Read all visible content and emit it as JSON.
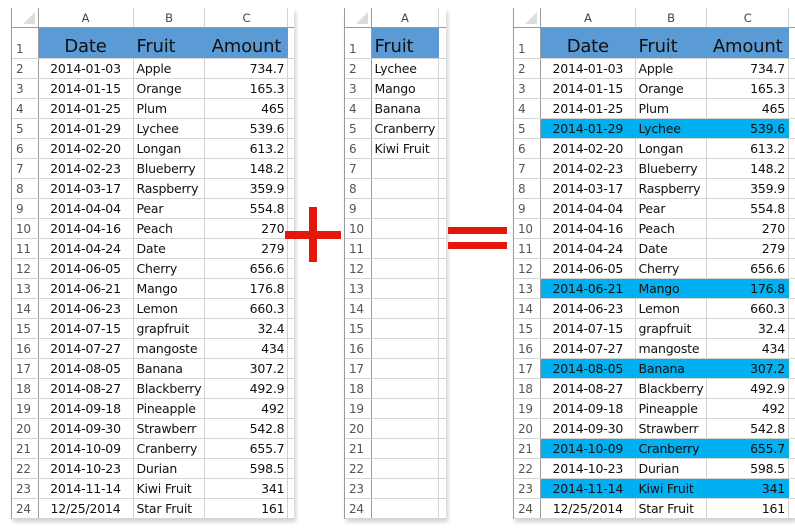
{
  "sheet1": {
    "col_headers": [
      "A",
      "B",
      "C"
    ],
    "header": {
      "row": "1",
      "cols": [
        "Date",
        "Fruit",
        "Amount"
      ]
    },
    "rows": [
      {
        "n": "2",
        "date": "2014-01-03",
        "fruit": "Apple",
        "amount": "734.7"
      },
      {
        "n": "3",
        "date": "2014-01-15",
        "fruit": "Orange",
        "amount": "165.3"
      },
      {
        "n": "4",
        "date": "2014-01-25",
        "fruit": "Plum",
        "amount": "465"
      },
      {
        "n": "5",
        "date": "2014-01-29",
        "fruit": "Lychee",
        "amount": "539.6"
      },
      {
        "n": "6",
        "date": "2014-02-20",
        "fruit": "Longan",
        "amount": "613.2"
      },
      {
        "n": "7",
        "date": "2014-02-23",
        "fruit": "Blueberry",
        "amount": "148.2"
      },
      {
        "n": "8",
        "date": "2014-03-17",
        "fruit": "Raspberry",
        "amount": "359.9"
      },
      {
        "n": "9",
        "date": "2014-04-04",
        "fruit": "Pear",
        "amount": "554.8"
      },
      {
        "n": "10",
        "date": "2014-04-16",
        "fruit": "Peach",
        "amount": "270"
      },
      {
        "n": "11",
        "date": "2014-04-24",
        "fruit": "Date",
        "amount": "279"
      },
      {
        "n": "12",
        "date": "2014-06-05",
        "fruit": "Cherry",
        "amount": "656.6"
      },
      {
        "n": "13",
        "date": "2014-06-21",
        "fruit": "Mango",
        "amount": "176.8"
      },
      {
        "n": "14",
        "date": "2014-06-23",
        "fruit": "Lemon",
        "amount": "660.3"
      },
      {
        "n": "15",
        "date": "2014-07-15",
        "fruit": "grapfruit",
        "amount": "32.4"
      },
      {
        "n": "16",
        "date": "2014-07-27",
        "fruit": "mangoste",
        "amount": "434"
      },
      {
        "n": "17",
        "date": "2014-08-05",
        "fruit": "Banana",
        "amount": "307.2"
      },
      {
        "n": "18",
        "date": "2014-08-27",
        "fruit": "Blackberry",
        "amount": "492.9"
      },
      {
        "n": "19",
        "date": "2014-09-18",
        "fruit": "Pineapple",
        "amount": "492"
      },
      {
        "n": "20",
        "date": "2014-09-30",
        "fruit": "Strawberr",
        "amount": "542.8"
      },
      {
        "n": "21",
        "date": "2014-10-09",
        "fruit": "Cranberry",
        "amount": "655.7"
      },
      {
        "n": "22",
        "date": "2014-10-23",
        "fruit": "Durian",
        "amount": "598.5"
      },
      {
        "n": "23",
        "date": "2014-11-14",
        "fruit": "Kiwi Fruit",
        "amount": "341"
      },
      {
        "n": "24",
        "date": "12/25/2014",
        "fruit": "Star Fruit",
        "amount": "161"
      }
    ]
  },
  "sheet2": {
    "col_headers": [
      "A"
    ],
    "header": {
      "row": "1",
      "cols": [
        "Fruit"
      ]
    },
    "rows": [
      {
        "n": "2",
        "fruit": "Lychee"
      },
      {
        "n": "3",
        "fruit": "Mango"
      },
      {
        "n": "4",
        "fruit": "Banana"
      },
      {
        "n": "5",
        "fruit": "Cranberry"
      },
      {
        "n": "6",
        "fruit": "Kiwi Fruit"
      },
      {
        "n": "7",
        "fruit": ""
      },
      {
        "n": "8",
        "fruit": ""
      },
      {
        "n": "9",
        "fruit": ""
      },
      {
        "n": "10",
        "fruit": ""
      },
      {
        "n": "11",
        "fruit": ""
      },
      {
        "n": "12",
        "fruit": ""
      },
      {
        "n": "13",
        "fruit": ""
      },
      {
        "n": "14",
        "fruit": ""
      },
      {
        "n": "15",
        "fruit": ""
      },
      {
        "n": "16",
        "fruit": ""
      },
      {
        "n": "17",
        "fruit": ""
      },
      {
        "n": "18",
        "fruit": ""
      },
      {
        "n": "19",
        "fruit": ""
      },
      {
        "n": "20",
        "fruit": ""
      },
      {
        "n": "21",
        "fruit": ""
      },
      {
        "n": "22",
        "fruit": ""
      },
      {
        "n": "23",
        "fruit": ""
      },
      {
        "n": "24",
        "fruit": ""
      }
    ]
  },
  "sheet3": {
    "col_headers": [
      "A",
      "B",
      "C"
    ],
    "header": {
      "row": "1",
      "cols": [
        "Date",
        "Fruit",
        "Amount"
      ]
    },
    "highlight_color": "#00b0f0",
    "highlighted_rows": [
      "5",
      "13",
      "17",
      "21",
      "23"
    ]
  },
  "colors": {
    "header_fill": "#5b9bd5",
    "highlight_fill": "#00b0f0",
    "operator_red": "#e3170a"
  },
  "operators": {
    "plus": "plus-sign",
    "equals": "equals-sign"
  }
}
